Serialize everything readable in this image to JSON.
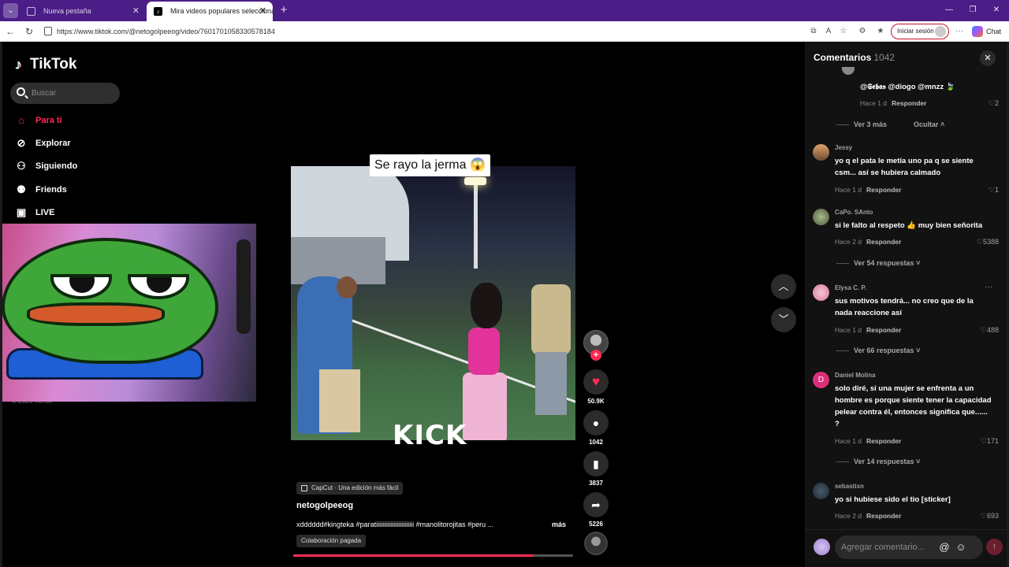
{
  "browser": {
    "tabs": [
      {
        "title": "Nueva pestaña"
      },
      {
        "title": "Mira videos populares seleccionados"
      }
    ],
    "url": "https://www.tiktok.com/@netogolpeeog/video/7601701058330578184",
    "signin_label": "Iniciar sesión",
    "chat_label": "Chat"
  },
  "sidebar": {
    "logo": "TikTok",
    "search_placeholder": "Buscar",
    "nav": [
      {
        "label": "Para ti",
        "icon": "home-icon",
        "active": true
      },
      {
        "label": "Explorar",
        "icon": "compass-icon"
      },
      {
        "label": "Siguiendo",
        "icon": "following-icon"
      },
      {
        "label": "Friends",
        "icon": "friends-icon"
      },
      {
        "label": "LIVE",
        "icon": "live-icon"
      }
    ],
    "copyright": "© 2026 TikTok"
  },
  "video": {
    "caption": "Se rayo la jerma 😱",
    "watermark": "KICK",
    "capcut_label": "CapCut · Una edición más fácil",
    "author": "netogolpeeog",
    "description": "xdddddd#kingteka #paratiiiiiiiiiiiiiiiiiiiiiiii #manolitorojitas  #peru ...",
    "more_label": "más",
    "paid_label": "Colaboración pagada",
    "progress": 0.86
  },
  "actions": {
    "likes": "50.9K",
    "comments": "1042",
    "saves": "3837",
    "shares": "5226"
  },
  "comments_panel": {
    "title": "Comentarios",
    "count": "1042",
    "partial_reply": {
      "text": "@𝕾𝖊𝖇𝖆𝖘 @diogo @mnzz 🍃",
      "time": "Hace 1 d",
      "reply": "Responder",
      "likes": "2"
    },
    "view_more": "Ver 3 más",
    "hide": "Ocultar",
    "comments": [
      {
        "user": "Jessy",
        "text": "yo q el pata le metía uno pa q se siente csm... así se hubiera calmado",
        "time": "Hace 1 d",
        "reply": "Responder",
        "likes": "1"
      },
      {
        "user": "CaPo. SAnto",
        "text": "si le falto al respeto 👍 muy bien señorita",
        "time": "Hace 2 d",
        "reply": "Responder",
        "likes": "5388",
        "replies": "Ver 54 respuestas"
      },
      {
        "user": "Elysa C. P.",
        "text": "sus motivos tendrá... no creo que de la nada reaccione así",
        "time": "Hace 1 d",
        "reply": "Responder",
        "likes": "488",
        "replies": "Ver 66 respuestas"
      },
      {
        "user": "Daniel Molina",
        "text": "solo diré, si una mujer se enfrenta a un hombre es porque siente tener la capacidad pelear contra él, entonces significa que...... ?",
        "time": "Hace 1 d",
        "reply": "Responder",
        "likes": "171",
        "replies": "Ver 14 respuestas",
        "initial": "D"
      },
      {
        "user": "sebastixn",
        "text": "yo si hubiese sido el tio [sticker]",
        "time": "Hace 2 d",
        "reply": "Responder",
        "likes": "693"
      }
    ],
    "composer_placeholder": "Agregar comentario..."
  },
  "colors": {
    "accent": "#fe2c55",
    "tab_bar": "#4a1e86"
  }
}
